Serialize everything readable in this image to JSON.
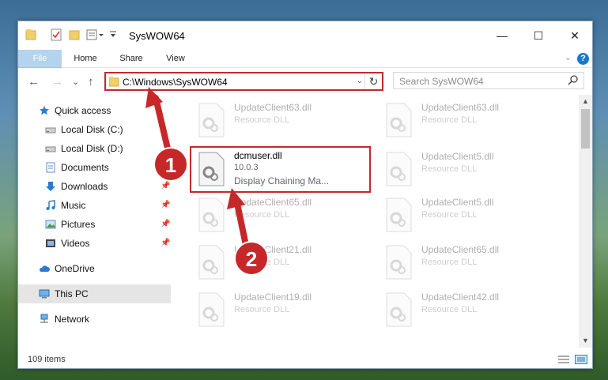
{
  "window": {
    "title": "SysWOW64",
    "controls": {
      "minimize": "—",
      "maximize": "☐",
      "close": "✕"
    }
  },
  "ribbon": {
    "tabs": [
      "File",
      "Home",
      "Share",
      "View"
    ],
    "help": "?",
    "expand": "⌄"
  },
  "navigation": {
    "back": "←",
    "forward": "→",
    "recent": "⌄",
    "up": "↑",
    "address": "C:\\Windows\\SysWOW64",
    "refresh": "↻",
    "search_placeholder": "Search SysWOW64"
  },
  "sidebar": {
    "items": [
      {
        "label": "Quick access",
        "icon": "star-icon"
      },
      {
        "label": "Local Disk (C:)",
        "icon": "drive-icon"
      },
      {
        "label": "Local Disk (D:)",
        "icon": "drive-icon"
      },
      {
        "label": "Documents",
        "icon": "documents-icon"
      },
      {
        "label": "Downloads",
        "icon": "downloads-icon"
      },
      {
        "label": "Music",
        "icon": "music-icon"
      },
      {
        "label": "Pictures",
        "icon": "pictures-icon"
      },
      {
        "label": "Videos",
        "icon": "videos-icon"
      },
      {
        "label": "OneDrive",
        "icon": "cloud-icon"
      },
      {
        "label": "This PC",
        "icon": "computer-icon"
      },
      {
        "label": "Network",
        "icon": "network-icon"
      }
    ]
  },
  "files": [
    {
      "name": "UpdateClient63.dll",
      "type": "Resource DLL"
    },
    {
      "name": "UpdateClient63.dll",
      "type": "Resource DLL"
    },
    {
      "name": "dcmuser.dll",
      "version": "10.0.3",
      "description": "Display Chaining Ma..."
    },
    {
      "name": "UpdateClient5.dll",
      "type": "Resource DLL"
    },
    {
      "name": "UpdateClient65.dll",
      "type": "Resource DLL"
    },
    {
      "name": "UpdateClient5.dll",
      "type": "Resource DLL"
    },
    {
      "name": "UpdateClient21.dll",
      "type": "Resource DLL"
    },
    {
      "name": "UpdateClient65.dll",
      "type": "Resource DLL"
    },
    {
      "name": "UpdateClient19.dll",
      "type": "Resource DLL"
    },
    {
      "name": "UpdateClient42.dll",
      "type": "Resource DLL"
    }
  ],
  "status": {
    "count": "109 items"
  },
  "annotations": {
    "step1": "1",
    "step2": "2",
    "color": "#c6282a"
  }
}
